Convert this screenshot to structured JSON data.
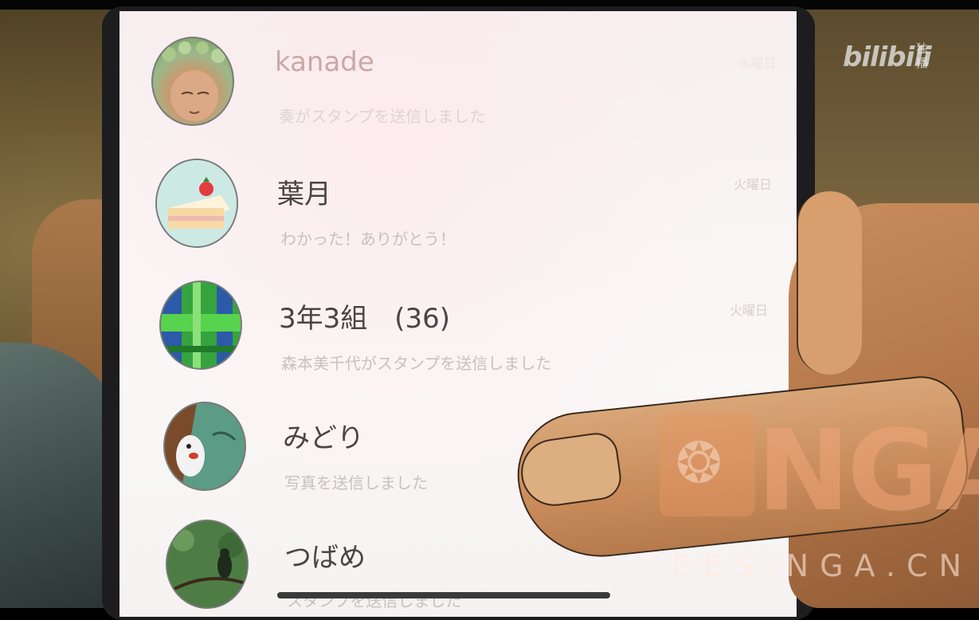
{
  "chats": [
    {
      "name": "kanade",
      "message": "奏がスタンプを送信しました",
      "date": "水曜日",
      "avatar": "girl-in-flower-wreath-avatar"
    },
    {
      "name": "葉月",
      "message": "わかった！ありがとう！",
      "date": "火曜日",
      "avatar": "strawberry-shortcake-avatar"
    },
    {
      "name": "3年3組　(36)",
      "message": "森本美千代がスタンプを送信しました",
      "date": "火曜日",
      "avatar": "green-plaid-avatar"
    },
    {
      "name": "みどり",
      "message": "写真を送信しました",
      "date": "",
      "avatar": "penguin-plush-avatar"
    },
    {
      "name": "つばめ",
      "message": "スタンプを送信しました",
      "date": "",
      "avatar": "bird-on-branch-avatar"
    }
  ],
  "watermarks": {
    "bilibili_logo": "bilibili",
    "bilibili_tag": "独播",
    "nga_logo": "NGA",
    "nga_url": "BBS.NGA.CN"
  },
  "colors": {
    "screen_bg": "#f8f3f3",
    "name_text": "#4a4444",
    "message_text": "#c7c1c1"
  }
}
